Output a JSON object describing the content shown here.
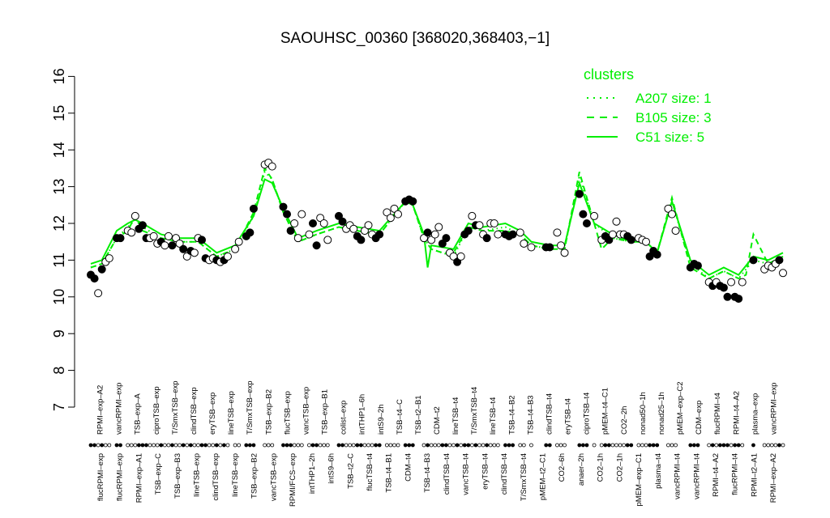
{
  "chart_data": {
    "type": "scatter",
    "title": "SAOUHSC_00360 [368020,368403,−1]",
    "xlabel": "",
    "ylabel": "",
    "ylim": [
      7,
      16
    ],
    "yticks": [
      "7",
      "8",
      "9",
      "10",
      "11",
      "12",
      "13",
      "14",
      "15",
      "16"
    ],
    "grid": false,
    "legend": {
      "title": "clusters",
      "position": "top-right",
      "color": "#00ee00",
      "entries": [
        {
          "label": "A207 size: 1",
          "style": "dotted"
        },
        {
          "label": "B105 size: 3",
          "style": "dashed"
        },
        {
          "label": "C51 size: 5",
          "style": "solid"
        }
      ]
    },
    "upper_labels": [
      "RPMI–exp–A2",
      "vancRPMI–exp",
      "TSB–exp–A",
      "ciproTSB–exp",
      "T/SmxTSB–exp",
      "clindTSB–exp",
      "eryTSB–exp",
      "lineTSB–exp",
      "T/SmxTSB–exp",
      "TSB–exp–B2",
      "flucTSB–exp",
      "vancTSB–exp",
      "TSB–exp–B1",
      "colist–exp",
      "intTHP1–6h",
      "intS9–2h",
      "TSB–t4–C",
      "TSB–t2–B1",
      "CDM–t2",
      "lineTSB–t4",
      "T/SmxTSB–t4",
      "lineTSB–t4",
      "TSB–t4–B2",
      "TSB–t4–B3",
      "clindTSB–t4",
      "eryTSB–t4",
      "ciproTSB–t4",
      "pMEM–t4–C1",
      "CO2–2h",
      "nonad50–1h",
      "nonad25–1h",
      "pMEM–exp–C2",
      "CDM–exp",
      "flucRPMI–t4",
      "RPMI–t4–A2",
      "plasma–exp",
      "vancRPMI–exp"
    ],
    "lower_labels": [
      "flucRPMI–exp",
      "flucRPMI–exp",
      "RPMI–exp–A1",
      "TSB–exp–C",
      "TSB–exp–B3",
      "lineTSB–exp",
      "clindTSB–exp",
      "lineTSB–exp",
      "TSB–exp–B2",
      "vancTSB–exp",
      "RPMI/FCS–exp",
      "intTHP1–2h",
      "intS9–6h",
      "TSB–t2–C",
      "flucTSB–t4",
      "TSB–t4–B1",
      "CDM–t4",
      "TSB–t4–B3",
      "clindTSB–t4",
      "vancTSB–t4",
      "eryTSB–t4",
      "clindTSB–t4",
      "T/SmxTSB–t4",
      "pMEM–t2–C1",
      "CO2–6h",
      "anaer–2h",
      "CO2–1h",
      "CO2–1h",
      "pMEM–exp–C1",
      "plasma–t4",
      "vancRPMI–t4",
      "vancRPMI–t4",
      "RPMI–t4–A2",
      "flucRPMI–t4",
      "RPMI–t2–A1",
      "RPMI–exp–A2"
    ],
    "points": [
      {
        "x": 1,
        "y": 10.6,
        "f": 1
      },
      {
        "x": 2,
        "y": 10.5,
        "f": 1
      },
      {
        "x": 3,
        "y": 10.1,
        "f": 0
      },
      {
        "x": 4,
        "y": 10.75,
        "f": 1
      },
      {
        "x": 5,
        "y": 10.95,
        "f": 0
      },
      {
        "x": 6,
        "y": 11.05,
        "f": 0
      },
      {
        "x": 8,
        "y": 11.6,
        "f": 1
      },
      {
        "x": 9,
        "y": 11.6,
        "f": 1
      },
      {
        "x": 11,
        "y": 11.8,
        "f": 0
      },
      {
        "x": 12,
        "y": 11.75,
        "f": 0
      },
      {
        "x": 13,
        "y": 12.2,
        "f": 0
      },
      {
        "x": 14,
        "y": 11.85,
        "f": 1
      },
      {
        "x": 15,
        "y": 11.95,
        "f": 1
      },
      {
        "x": 16,
        "y": 11.6,
        "f": 1
      },
      {
        "x": 17,
        "y": 11.6,
        "f": 0
      },
      {
        "x": 18,
        "y": 11.65,
        "f": 0
      },
      {
        "x": 19,
        "y": 11.45,
        "f": 0
      },
      {
        "x": 20,
        "y": 11.5,
        "f": 1
      },
      {
        "x": 21,
        "y": 11.4,
        "f": 0
      },
      {
        "x": 22,
        "y": 11.65,
        "f": 0
      },
      {
        "x": 23,
        "y": 11.4,
        "f": 1
      },
      {
        "x": 24,
        "y": 11.6,
        "f": 0
      },
      {
        "x": 25,
        "y": 11.45,
        "f": 0
      },
      {
        "x": 26,
        "y": 11.3,
        "f": 1
      },
      {
        "x": 27,
        "y": 11.1,
        "f": 0
      },
      {
        "x": 28,
        "y": 11.25,
        "f": 1
      },
      {
        "x": 29,
        "y": 11.2,
        "f": 0
      },
      {
        "x": 30,
        "y": 11.6,
        "f": 0
      },
      {
        "x": 31,
        "y": 11.55,
        "f": 1
      },
      {
        "x": 32,
        "y": 11.05,
        "f": 1
      },
      {
        "x": 33,
        "y": 11.0,
        "f": 0
      },
      {
        "x": 34,
        "y": 11.05,
        "f": 0
      },
      {
        "x": 35,
        "y": 11.0,
        "f": 1
      },
      {
        "x": 36,
        "y": 10.95,
        "f": 0
      },
      {
        "x": 37,
        "y": 11.0,
        "f": 1
      },
      {
        "x": 38,
        "y": 11.1,
        "f": 0
      },
      {
        "x": 40,
        "y": 11.3,
        "f": 0
      },
      {
        "x": 41,
        "y": 11.5,
        "f": 0
      },
      {
        "x": 43,
        "y": 11.65,
        "f": 1
      },
      {
        "x": 44,
        "y": 11.75,
        "f": 1
      },
      {
        "x": 45,
        "y": 12.4,
        "f": 1
      },
      {
        "x": 48,
        "y": 13.6,
        "f": 0
      },
      {
        "x": 49,
        "y": 13.65,
        "f": 0
      },
      {
        "x": 50,
        "y": 13.55,
        "f": 0
      },
      {
        "x": 53,
        "y": 12.45,
        "f": 1
      },
      {
        "x": 54,
        "y": 12.25,
        "f": 1
      },
      {
        "x": 55,
        "y": 11.8,
        "f": 1
      },
      {
        "x": 56,
        "y": 12.0,
        "f": 0
      },
      {
        "x": 57,
        "y": 11.6,
        "f": 0
      },
      {
        "x": 58,
        "y": 12.25,
        "f": 0
      },
      {
        "x": 60,
        "y": 11.7,
        "f": 0
      },
      {
        "x": 61,
        "y": 12.0,
        "f": 1
      },
      {
        "x": 62,
        "y": 11.4,
        "f": 1
      },
      {
        "x": 63,
        "y": 12.15,
        "f": 0
      },
      {
        "x": 64,
        "y": 12.0,
        "f": 0
      },
      {
        "x": 65,
        "y": 11.55,
        "f": 0
      },
      {
        "x": 68,
        "y": 12.2,
        "f": 1
      },
      {
        "x": 69,
        "y": 12.05,
        "f": 1
      },
      {
        "x": 70,
        "y": 11.85,
        "f": 0
      },
      {
        "x": 71,
        "y": 11.95,
        "f": 0
      },
      {
        "x": 72,
        "y": 11.85,
        "f": 0
      },
      {
        "x": 73,
        "y": 11.65,
        "f": 1
      },
      {
        "x": 74,
        "y": 11.55,
        "f": 1
      },
      {
        "x": 75,
        "y": 11.8,
        "f": 0
      },
      {
        "x": 76,
        "y": 11.95,
        "f": 0
      },
      {
        "x": 77,
        "y": 11.7,
        "f": 0
      },
      {
        "x": 78,
        "y": 11.6,
        "f": 1
      },
      {
        "x": 79,
        "y": 11.7,
        "f": 1
      },
      {
        "x": 81,
        "y": 12.3,
        "f": 0
      },
      {
        "x": 82,
        "y": 12.15,
        "f": 0
      },
      {
        "x": 83,
        "y": 12.4,
        "f": 0
      },
      {
        "x": 84,
        "y": 12.25,
        "f": 0
      },
      {
        "x": 86,
        "y": 12.6,
        "f": 1
      },
      {
        "x": 87,
        "y": 12.65,
        "f": 1
      },
      {
        "x": 88,
        "y": 12.6,
        "f": 1
      },
      {
        "x": 91,
        "y": 11.6,
        "f": 0
      },
      {
        "x": 92,
        "y": 11.75,
        "f": 1
      },
      {
        "x": 93,
        "y": 11.55,
        "f": 0
      },
      {
        "x": 94,
        "y": 11.7,
        "f": 0
      },
      {
        "x": 95,
        "y": 11.9,
        "f": 0
      },
      {
        "x": 96,
        "y": 11.45,
        "f": 1
      },
      {
        "x": 97,
        "y": 11.6,
        "f": 1
      },
      {
        "x": 98,
        "y": 11.2,
        "f": 0
      },
      {
        "x": 99,
        "y": 11.1,
        "f": 0
      },
      {
        "x": 100,
        "y": 10.95,
        "f": 1
      },
      {
        "x": 101,
        "y": 11.1,
        "f": 0
      },
      {
        "x": 102,
        "y": 11.7,
        "f": 1
      },
      {
        "x": 103,
        "y": 11.8,
        "f": 1
      },
      {
        "x": 104,
        "y": 12.2,
        "f": 0
      },
      {
        "x": 105,
        "y": 11.95,
        "f": 1
      },
      {
        "x": 106,
        "y": 11.95,
        "f": 0
      },
      {
        "x": 107,
        "y": 11.7,
        "f": 0
      },
      {
        "x": 108,
        "y": 11.6,
        "f": 1
      },
      {
        "x": 109,
        "y": 12.0,
        "f": 0
      },
      {
        "x": 110,
        "y": 12.0,
        "f": 0
      },
      {
        "x": 111,
        "y": 11.7,
        "f": 0
      },
      {
        "x": 113,
        "y": 11.7,
        "f": 1
      },
      {
        "x": 114,
        "y": 11.65,
        "f": 1
      },
      {
        "x": 115,
        "y": 11.7,
        "f": 1
      },
      {
        "x": 117,
        "y": 11.75,
        "f": 0
      },
      {
        "x": 118,
        "y": 11.45,
        "f": 0
      },
      {
        "x": 120,
        "y": 11.35,
        "f": 0
      },
      {
        "x": 124,
        "y": 11.35,
        "f": 1
      },
      {
        "x": 125,
        "y": 11.35,
        "f": 1
      },
      {
        "x": 127,
        "y": 11.75,
        "f": 0
      },
      {
        "x": 128,
        "y": 11.4,
        "f": 0
      },
      {
        "x": 129,
        "y": 11.2,
        "f": 0
      },
      {
        "x": 133,
        "y": 12.8,
        "f": 1
      },
      {
        "x": 134,
        "y": 12.25,
        "f": 1
      },
      {
        "x": 135,
        "y": 12.0,
        "f": 1
      },
      {
        "x": 137,
        "y": 12.2,
        "f": 0
      },
      {
        "x": 139,
        "y": 11.55,
        "f": 0
      },
      {
        "x": 140,
        "y": 11.65,
        "f": 1
      },
      {
        "x": 141,
        "y": 11.55,
        "f": 1
      },
      {
        "x": 142,
        "y": 11.7,
        "f": 0
      },
      {
        "x": 143,
        "y": 12.05,
        "f": 0
      },
      {
        "x": 144,
        "y": 11.7,
        "f": 0
      },
      {
        "x": 145,
        "y": 11.7,
        "f": 0
      },
      {
        "x": 146,
        "y": 11.65,
        "f": 1
      },
      {
        "x": 147,
        "y": 11.55,
        "f": 1
      },
      {
        "x": 149,
        "y": 11.6,
        "f": 0
      },
      {
        "x": 150,
        "y": 11.55,
        "f": 0
      },
      {
        "x": 151,
        "y": 11.5,
        "f": 0
      },
      {
        "x": 152,
        "y": 11.1,
        "f": 1
      },
      {
        "x": 153,
        "y": 11.25,
        "f": 1
      },
      {
        "x": 154,
        "y": 11.15,
        "f": 1
      },
      {
        "x": 157,
        "y": 12.4,
        "f": 0
      },
      {
        "x": 158,
        "y": 12.25,
        "f": 0
      },
      {
        "x": 159,
        "y": 11.8,
        "f": 0
      },
      {
        "x": 163,
        "y": 10.8,
        "f": 1
      },
      {
        "x": 164,
        "y": 10.9,
        "f": 1
      },
      {
        "x": 165,
        "y": 10.85,
        "f": 1
      },
      {
        "x": 168,
        "y": 10.4,
        "f": 0
      },
      {
        "x": 169,
        "y": 10.3,
        "f": 1
      },
      {
        "x": 170,
        "y": 10.4,
        "f": 0
      },
      {
        "x": 171,
        "y": 10.3,
        "f": 1
      },
      {
        "x": 172,
        "y": 10.25,
        "f": 1
      },
      {
        "x": 173,
        "y": 10.0,
        "f": 1
      },
      {
        "x": 174,
        "y": 10.4,
        "f": 0
      },
      {
        "x": 175,
        "y": 10.0,
        "f": 1
      },
      {
        "x": 176,
        "y": 9.95,
        "f": 1
      },
      {
        "x": 177,
        "y": 10.4,
        "f": 0
      },
      {
        "x": 180,
        "y": 11.0,
        "f": 1
      },
      {
        "x": 183,
        "y": 10.75,
        "f": 0
      },
      {
        "x": 184,
        "y": 10.85,
        "f": 0
      },
      {
        "x": 185,
        "y": 10.8,
        "f": 0
      },
      {
        "x": 186,
        "y": 10.9,
        "f": 0
      },
      {
        "x": 187,
        "y": 11.0,
        "f": 1
      },
      {
        "x": 188,
        "y": 10.65,
        "f": 0
      }
    ],
    "series": [
      {
        "style": "solid",
        "color": "#00ee00",
        "x": [
          1,
          4,
          8,
          11,
          13,
          15,
          20,
          25,
          30,
          35,
          40,
          45,
          48,
          50,
          53,
          57,
          62,
          68,
          73,
          79,
          86,
          88,
          91,
          92,
          93,
          99,
          103,
          107,
          113,
          117,
          120,
          125,
          129,
          133,
          137,
          142,
          147,
          151,
          154,
          158,
          163,
          168,
          172,
          176,
          180,
          184,
          188
        ],
        "y": [
          10.9,
          11.0,
          11.8,
          12.0,
          12.1,
          12.0,
          11.7,
          11.6,
          11.6,
          11.2,
          11.4,
          12.2,
          13.2,
          13.1,
          12.4,
          11.6,
          11.8,
          12.0,
          11.9,
          11.8,
          12.6,
          12.5,
          11.7,
          10.8,
          11.4,
          11.3,
          12.0,
          11.9,
          12.0,
          11.8,
          11.5,
          11.4,
          11.4,
          13.1,
          12.0,
          11.7,
          11.5,
          11.5,
          11.2,
          12.6,
          11.0,
          10.6,
          10.8,
          10.6,
          11.1,
          11.0,
          11.2
        ]
      },
      {
        "style": "dashed",
        "color": "#00ee00",
        "x": [
          1,
          4,
          8,
          11,
          13,
          15,
          20,
          25,
          30,
          35,
          40,
          45,
          48,
          50,
          53,
          57,
          62,
          68,
          73,
          79,
          86,
          88,
          91,
          93,
          96,
          99,
          103,
          107,
          113,
          117,
          120,
          125,
          129,
          133,
          137,
          139,
          142,
          147,
          151,
          154,
          158,
          163,
          168,
          172,
          176,
          178,
          180,
          184,
          188
        ],
        "y": [
          10.8,
          10.9,
          11.6,
          11.8,
          12.2,
          11.8,
          11.6,
          11.5,
          11.5,
          11.1,
          11.3,
          12.3,
          13.5,
          13.2,
          12.3,
          11.5,
          11.7,
          11.9,
          11.8,
          11.7,
          12.6,
          12.5,
          11.6,
          11.3,
          11.2,
          11.2,
          11.9,
          11.8,
          11.8,
          11.7,
          11.4,
          11.3,
          11.3,
          13.4,
          12.0,
          11.3,
          11.6,
          11.5,
          11.5,
          11.2,
          12.7,
          10.8,
          10.5,
          10.7,
          10.5,
          10.6,
          11.7,
          10.9,
          11.1
        ]
      },
      {
        "style": "dotted",
        "color": "#00ee00",
        "x": [
          1,
          4,
          8,
          11,
          13,
          15,
          20,
          25,
          30,
          35,
          40,
          45,
          48,
          50,
          53,
          57,
          62,
          68,
          73,
          79,
          86,
          88,
          91,
          93,
          96,
          99,
          103,
          107,
          113,
          117,
          120,
          125,
          129,
          133,
          137,
          142,
          147,
          151,
          154,
          158,
          163,
          168,
          172,
          176,
          180,
          184,
          188
        ],
        "y": [
          10.8,
          10.9,
          11.6,
          11.9,
          12.1,
          11.9,
          11.6,
          11.5,
          11.5,
          11.1,
          11.3,
          12.2,
          13.4,
          13.2,
          12.3,
          11.5,
          11.7,
          11.9,
          11.8,
          11.7,
          12.6,
          12.5,
          11.6,
          11.3,
          11.2,
          11.1,
          11.9,
          11.8,
          11.9,
          11.7,
          11.4,
          11.3,
          11.3,
          13.3,
          12.0,
          11.6,
          11.5,
          11.5,
          11.2,
          12.6,
          10.9,
          10.5,
          10.7,
          10.5,
          11.0,
          10.9,
          11.1
        ]
      }
    ]
  }
}
